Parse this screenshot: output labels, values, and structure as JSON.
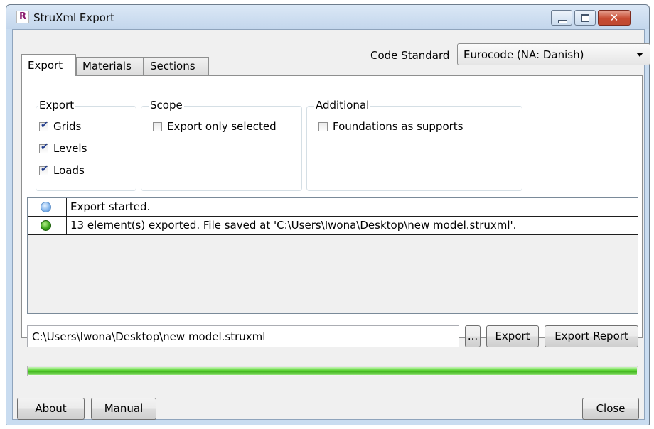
{
  "window": {
    "title": "StruXml Export",
    "app_icon": "R",
    "close_glyph": "✕"
  },
  "tabs": [
    {
      "label": "Export",
      "active": true
    },
    {
      "label": "Materials",
      "active": false
    },
    {
      "label": "Sections",
      "active": false
    }
  ],
  "code_standard": {
    "label": "Code Standard",
    "value": "Eurocode (NA: Danish)"
  },
  "groups": {
    "export": {
      "title": "Export",
      "items": [
        {
          "label": "Grids",
          "checked": true
        },
        {
          "label": "Levels",
          "checked": true
        },
        {
          "label": "Loads",
          "checked": true
        }
      ]
    },
    "scope": {
      "title": "Scope",
      "items": [
        {
          "label": "Export only selected",
          "checked": false
        }
      ]
    },
    "additional": {
      "title": "Additional",
      "items": [
        {
          "label": "Foundations as supports",
          "checked": false
        }
      ]
    }
  },
  "log": [
    {
      "status": "info",
      "icon": "blue-info-dot-icon",
      "text": "Export started."
    },
    {
      "status": "success",
      "icon": "green-success-dot-icon",
      "text": "13 element(s) exported. File saved at 'C:\\Users\\Iwona\\Desktop\\new model.struxml'."
    }
  ],
  "file_path": {
    "value": "C:\\Users\\Iwona\\Desktop\\new model.struxml"
  },
  "buttons": {
    "browse": "...",
    "export": "Export",
    "export_report": "Export Report",
    "about": "About",
    "manual": "Manual",
    "close": "Close"
  },
  "progress": {
    "value": 1.0
  },
  "colors": {
    "progress_green": "#3fb61b",
    "close_red": "#c64b32",
    "title_bar": "#c9dcf0"
  }
}
